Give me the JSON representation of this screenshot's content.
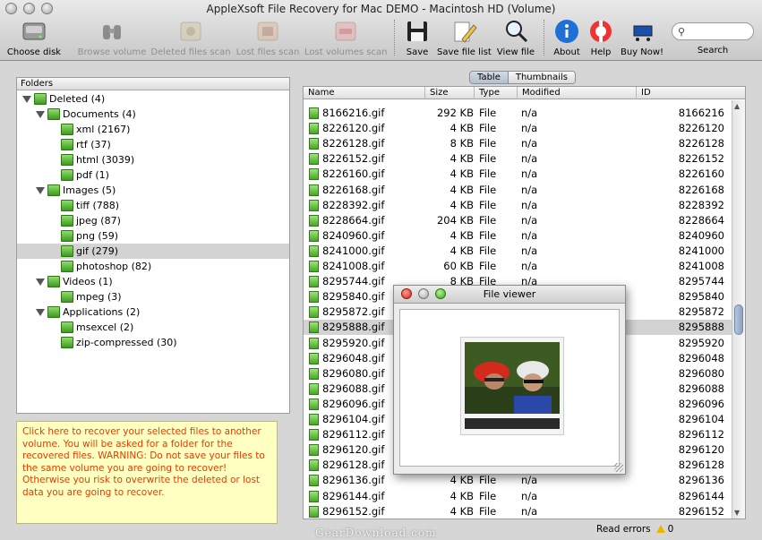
{
  "window": {
    "title": "AppleXsoft File Recovery for Mac DEMO - Macintosh HD (Volume)"
  },
  "toolbar": {
    "choose_disk": "Choose disk",
    "browse_volume": "Browse volume",
    "deleted_files_scan": "Deleted files scan",
    "lost_files_scan": "Lost files scan",
    "lost_volumes_scan": "Lost volumes scan",
    "save": "Save",
    "save_file_list": "Save file list",
    "view_file": "View file",
    "about": "About",
    "help": "Help",
    "buy_now": "Buy Now!",
    "search_label": "Search",
    "search_value": ""
  },
  "folders": {
    "header": "Folders",
    "items": [
      {
        "label": "Deleted (4)",
        "level": 0,
        "expanded": true
      },
      {
        "label": "Documents (4)",
        "level": 1,
        "expanded": true
      },
      {
        "label": "xml (2167)",
        "level": 2
      },
      {
        "label": "rtf (37)",
        "level": 2
      },
      {
        "label": "html (3039)",
        "level": 2
      },
      {
        "label": "pdf (1)",
        "level": 2
      },
      {
        "label": "Images (5)",
        "level": 1,
        "expanded": true
      },
      {
        "label": "tiff (788)",
        "level": 2
      },
      {
        "label": "jpeg (87)",
        "level": 2
      },
      {
        "label": "png (59)",
        "level": 2
      },
      {
        "label": "gif (279)",
        "level": 2,
        "selected": true
      },
      {
        "label": "photoshop (82)",
        "level": 2
      },
      {
        "label": "Videos (1)",
        "level": 1,
        "expanded": true
      },
      {
        "label": "mpeg (3)",
        "level": 2
      },
      {
        "label": "Applications (2)",
        "level": 1,
        "expanded": true
      },
      {
        "label": "msexcel (2)",
        "level": 2
      },
      {
        "label": "zip-compressed (30)",
        "level": 2
      }
    ]
  },
  "recover_note": "Click here to recover your selected files to another volume. You will be asked for a folder for the recovered files. WARNING: Do not save your files to the same volume you are going to recover! Otherwise you risk to overwrite the deleted or lost data you are going to recover.",
  "view_tabs": {
    "table": "Table",
    "thumbnails": "Thumbnails",
    "active": "table"
  },
  "file_table": {
    "columns": {
      "name": "Name",
      "size": "Size",
      "type": "Type",
      "modified": "Modified",
      "id": "ID"
    },
    "rows": [
      {
        "name": "8166216.gif",
        "size": "292 KB",
        "type": "File",
        "modified": "n/a",
        "id": "8166216"
      },
      {
        "name": "8226120.gif",
        "size": "4 KB",
        "type": "File",
        "modified": "n/a",
        "id": "8226120"
      },
      {
        "name": "8226128.gif",
        "size": "8 KB",
        "type": "File",
        "modified": "n/a",
        "id": "8226128"
      },
      {
        "name": "8226152.gif",
        "size": "4 KB",
        "type": "File",
        "modified": "n/a",
        "id": "8226152"
      },
      {
        "name": "8226160.gif",
        "size": "4 KB",
        "type": "File",
        "modified": "n/a",
        "id": "8226160"
      },
      {
        "name": "8226168.gif",
        "size": "4 KB",
        "type": "File",
        "modified": "n/a",
        "id": "8226168"
      },
      {
        "name": "8228392.gif",
        "size": "4 KB",
        "type": "File",
        "modified": "n/a",
        "id": "8228392"
      },
      {
        "name": "8228664.gif",
        "size": "204 KB",
        "type": "File",
        "modified": "n/a",
        "id": "8228664"
      },
      {
        "name": "8240960.gif",
        "size": "4 KB",
        "type": "File",
        "modified": "n/a",
        "id": "8240960"
      },
      {
        "name": "8241000.gif",
        "size": "4 KB",
        "type": "File",
        "modified": "n/a",
        "id": "8241000"
      },
      {
        "name": "8241008.gif",
        "size": "60 KB",
        "type": "File",
        "modified": "n/a",
        "id": "8241008"
      },
      {
        "name": "8295744.gif",
        "size": "8 KB",
        "type": "File",
        "modified": "n/a",
        "id": "8295744"
      },
      {
        "name": "8295840.gif",
        "size": "",
        "type": "",
        "modified": "",
        "id": "8295840"
      },
      {
        "name": "8295872.gif",
        "size": "",
        "type": "",
        "modified": "",
        "id": "8295872"
      },
      {
        "name": "8295888.gif",
        "size": "",
        "type": "",
        "modified": "",
        "id": "8295888",
        "selected": true
      },
      {
        "name": "8295920.gif",
        "size": "",
        "type": "",
        "modified": "",
        "id": "8295920"
      },
      {
        "name": "8296048.gif",
        "size": "",
        "type": "",
        "modified": "",
        "id": "8296048"
      },
      {
        "name": "8296080.gif",
        "size": "",
        "type": "",
        "modified": "",
        "id": "8296080"
      },
      {
        "name": "8296088.gif",
        "size": "",
        "type": "",
        "modified": "",
        "id": "8296088"
      },
      {
        "name": "8296096.gif",
        "size": "",
        "type": "",
        "modified": "",
        "id": "8296096"
      },
      {
        "name": "8296104.gif",
        "size": "",
        "type": "",
        "modified": "",
        "id": "8296104"
      },
      {
        "name": "8296112.gif",
        "size": "",
        "type": "",
        "modified": "",
        "id": "8296112"
      },
      {
        "name": "8296120.gif",
        "size": "",
        "type": "",
        "modified": "",
        "id": "8296120"
      },
      {
        "name": "8296128.gif",
        "size": "",
        "type": "",
        "modified": "",
        "id": "8296128"
      },
      {
        "name": "8296136.gif",
        "size": "4 KB",
        "type": "File",
        "modified": "n/a",
        "id": "8296136"
      },
      {
        "name": "8296144.gif",
        "size": "4 KB",
        "type": "File",
        "modified": "n/a",
        "id": "8296144"
      },
      {
        "name": "8296152.gif",
        "size": "4 KB",
        "type": "File",
        "modified": "n/a",
        "id": "8296152"
      }
    ]
  },
  "file_viewer": {
    "title": "File viewer"
  },
  "status": {
    "read_errors_label": "Read errors",
    "read_errors_count": "0"
  },
  "watermark": "GearDownload.com",
  "colors": {
    "folder_green": "#4caa28",
    "note_text": "#e43c00",
    "note_bg": "#ffffc2",
    "selection": "#d3d3d3"
  }
}
